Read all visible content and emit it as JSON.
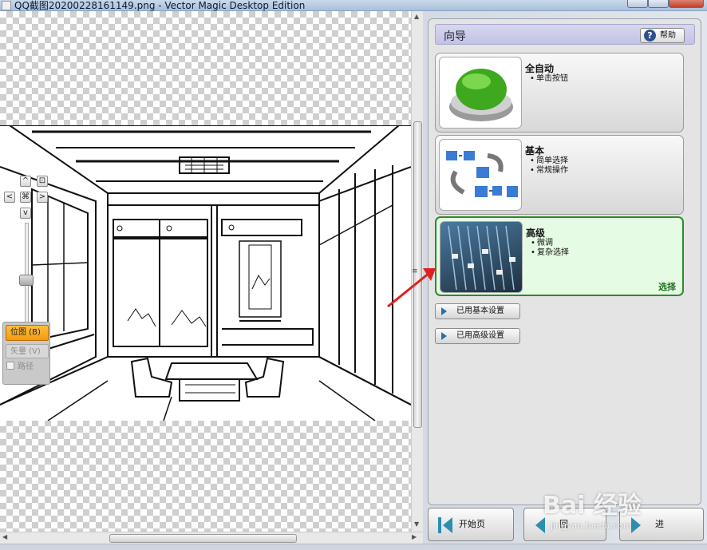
{
  "window": {
    "title": "QQ截图20200228161149.png - Vector Magic Desktop Edition"
  },
  "canvas_controls": {
    "up": "^",
    "down": "v",
    "left": "<",
    "right": ">",
    "center": "⌘",
    "fit": "⊡",
    "modes": {
      "bitmap": "位图 (B)",
      "vector": "矢量 (V)",
      "paths": "路径"
    }
  },
  "wizard": {
    "title": "向导",
    "help": "帮助",
    "options": [
      {
        "title": "全自动",
        "bullets": [
          "单击按钮"
        ]
      },
      {
        "title": "基本",
        "bullets": [
          "简单选择",
          "常规操作"
        ]
      },
      {
        "title": "高级",
        "bullets": [
          "微调",
          "复杂选择"
        ],
        "select_label": "选择"
      }
    ],
    "basic_settings": "已用基本设置",
    "advanced_settings": "已用高级设置"
  },
  "footer": {
    "start_page": "开始页",
    "back": "回",
    "next": "进"
  },
  "watermark": {
    "brand": "Bai 经验",
    "url": "jingyan.baidu.com"
  },
  "colors": {
    "selected_border": "#2e8a2a",
    "selected_bg": "#e6fbe4",
    "accent_orange": "#f39a12",
    "nav_blue": "#2c8fb0"
  }
}
